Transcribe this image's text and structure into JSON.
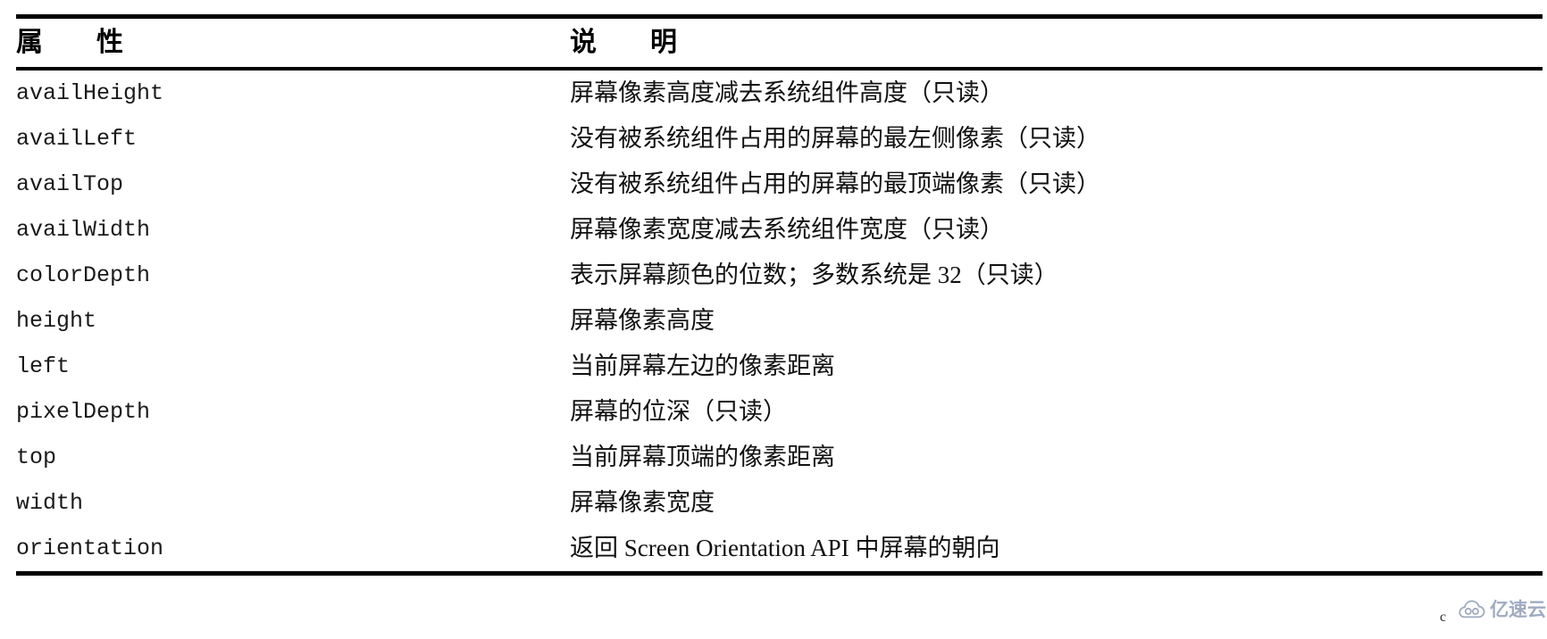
{
  "table": {
    "headers": {
      "property": "属　　性",
      "description": "说　　明"
    },
    "rows": [
      {
        "property": "availHeight",
        "description": "屏幕像素高度减去系统组件高度（只读）"
      },
      {
        "property": "availLeft",
        "description": "没有被系统组件占用的屏幕的最左侧像素（只读）"
      },
      {
        "property": "availTop",
        "description": "没有被系统组件占用的屏幕的最顶端像素（只读）"
      },
      {
        "property": "availWidth",
        "description": "屏幕像素宽度减去系统组件宽度（只读）"
      },
      {
        "property": "colorDepth",
        "description": "表示屏幕颜色的位数；多数系统是 32（只读）"
      },
      {
        "property": "height",
        "description": "屏幕像素高度"
      },
      {
        "property": "left",
        "description": "当前屏幕左边的像素距离"
      },
      {
        "property": "pixelDepth",
        "description": "屏幕的位深（只读）"
      },
      {
        "property": "top",
        "description": "当前屏幕顶端的像素距离"
      },
      {
        "property": "width",
        "description": "屏幕像素宽度"
      },
      {
        "property": "orientation",
        "description": "返回 Screen Orientation API 中屏幕的朝向"
      }
    ]
  },
  "watermark": {
    "text": "亿速云",
    "icon": "cloud-icon",
    "color": "#9aa7bd"
  },
  "artifacts": {
    "stray_mark": "c"
  }
}
